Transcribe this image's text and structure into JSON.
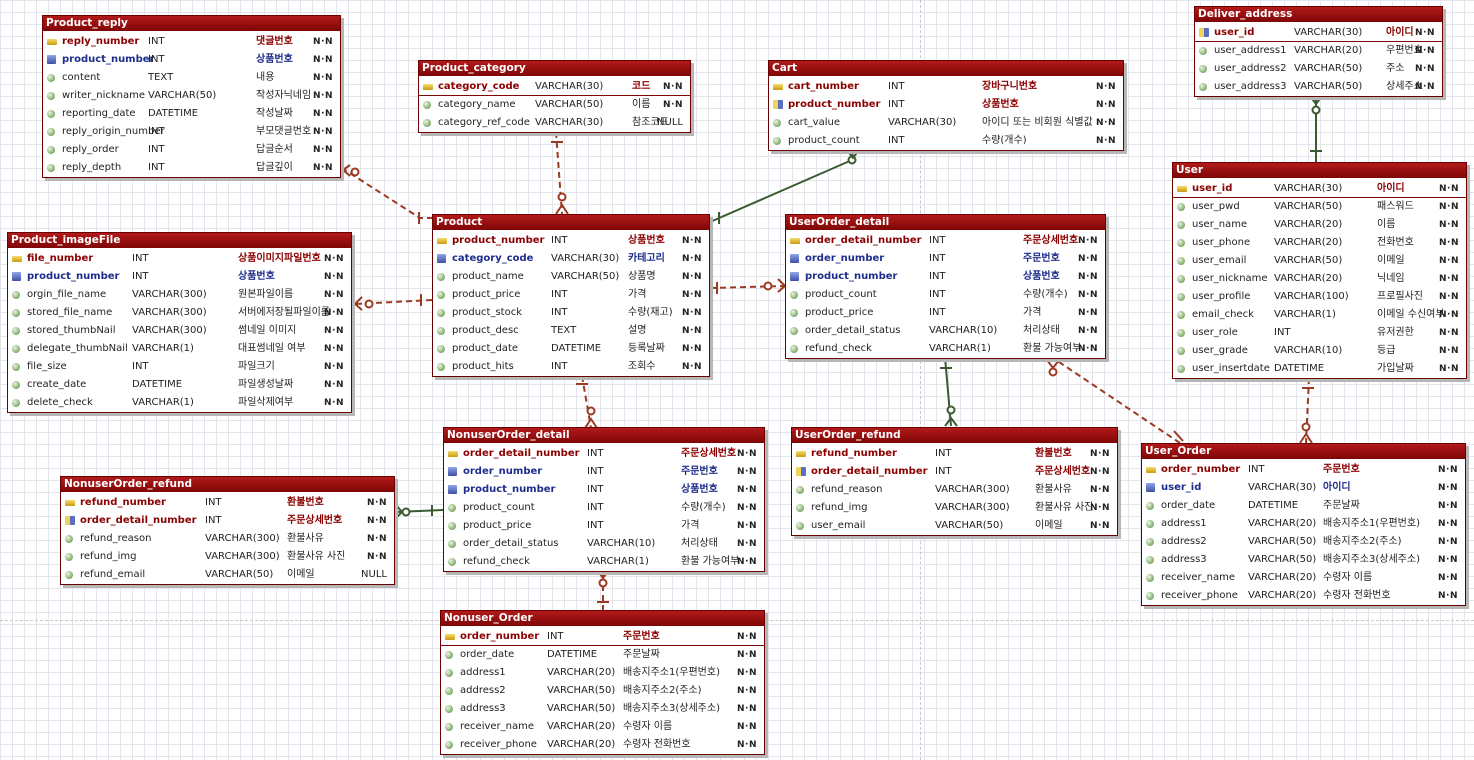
{
  "entities": [
    {
      "id": "product_reply",
      "name": "Product_reply",
      "columns": [
        {
          "name": "reply_number",
          "type": "INT",
          "comment": "댓글번호",
          "nullable": "N·N",
          "role": "pk"
        },
        {
          "name": "product_number",
          "type": "INT",
          "comment": "상품번호",
          "nullable": "N·N",
          "role": "fk"
        },
        {
          "name": "content",
          "type": "TEXT",
          "comment": "내용",
          "nullable": "N·N",
          "role": ""
        },
        {
          "name": "writer_nickname",
          "type": "VARCHAR(50)",
          "comment": "작성자닉네임",
          "nullable": "N·N",
          "role": ""
        },
        {
          "name": "reporting_date",
          "type": "DATETIME",
          "comment": "작성날짜",
          "nullable": "N·N",
          "role": ""
        },
        {
          "name": "reply_origin_number",
          "type": "INT",
          "comment": "부모댓글번호",
          "nullable": "N·N",
          "role": ""
        },
        {
          "name": "reply_order",
          "type": "INT",
          "comment": "답글순서",
          "nullable": "N·N",
          "role": ""
        },
        {
          "name": "reply_depth",
          "type": "INT",
          "comment": "답글깊이",
          "nullable": "N·N",
          "role": ""
        }
      ]
    },
    {
      "id": "product_category",
      "name": "Product_category",
      "columns": [
        {
          "name": "category_code",
          "type": "VARCHAR(30)",
          "comment": "코드",
          "nullable": "N·N",
          "role": "pk"
        },
        {
          "name": "category_name",
          "type": "VARCHAR(50)",
          "comment": "이름",
          "nullable": "N·N",
          "role": ""
        },
        {
          "name": "category_ref_code",
          "type": "VARCHAR(30)",
          "comment": "참조코드",
          "nullable": "NULL",
          "role": ""
        }
      ]
    },
    {
      "id": "cart",
      "name": "Cart",
      "columns": [
        {
          "name": "cart_number",
          "type": "INT",
          "comment": "장바구니번호",
          "nullable": "N·N",
          "role": "pk"
        },
        {
          "name": "product_number",
          "type": "INT",
          "comment": "상품번호",
          "nullable": "N·N",
          "role": "pkfk-red"
        },
        {
          "name": "cart_value",
          "type": "VARCHAR(30)",
          "comment": "아이디 또는 비회원 식별값",
          "nullable": "N·N",
          "role": ""
        },
        {
          "name": "product_count",
          "type": "INT",
          "comment": "수량(개수)",
          "nullable": "N·N",
          "role": ""
        }
      ]
    },
    {
      "id": "deliver_address",
      "name": "Deliver_address",
      "columns": [
        {
          "name": "user_id",
          "type": "VARCHAR(30)",
          "comment": "아이디",
          "nullable": "N·N",
          "role": "pkfk-red"
        },
        {
          "name": "user_address1",
          "type": "VARCHAR(20)",
          "comment": "우편번호",
          "nullable": "N·N",
          "role": ""
        },
        {
          "name": "user_address2",
          "type": "VARCHAR(50)",
          "comment": "주소",
          "nullable": "N·N",
          "role": ""
        },
        {
          "name": "user_address3",
          "type": "VARCHAR(50)",
          "comment": "상세주소",
          "nullable": "N·N",
          "role": ""
        }
      ]
    },
    {
      "id": "user",
      "name": "User",
      "columns": [
        {
          "name": "user_id",
          "type": "VARCHAR(30)",
          "comment": "아이디",
          "nullable": "N·N",
          "role": "pk"
        },
        {
          "name": "user_pwd",
          "type": "VARCHAR(50)",
          "comment": "패스워드",
          "nullable": "N·N",
          "role": ""
        },
        {
          "name": "user_name",
          "type": "VARCHAR(20)",
          "comment": "이름",
          "nullable": "N·N",
          "role": ""
        },
        {
          "name": "user_phone",
          "type": "VARCHAR(20)",
          "comment": "전화번호",
          "nullable": "N·N",
          "role": ""
        },
        {
          "name": "user_email",
          "type": "VARCHAR(50)",
          "comment": "이메일",
          "nullable": "N·N",
          "role": ""
        },
        {
          "name": "user_nickname",
          "type": "VARCHAR(20)",
          "comment": "닉네임",
          "nullable": "N·N",
          "role": ""
        },
        {
          "name": "user_profile",
          "type": "VARCHAR(100)",
          "comment": "프로필사진",
          "nullable": "N·N",
          "role": ""
        },
        {
          "name": "email_check",
          "type": "VARCHAR(1)",
          "comment": "이메일 수신여부",
          "nullable": "N·N",
          "role": ""
        },
        {
          "name": "user_role",
          "type": "INT",
          "comment": "유저권한",
          "nullable": "N·N",
          "role": ""
        },
        {
          "name": "user_grade",
          "type": "VARCHAR(10)",
          "comment": "등급",
          "nullable": "N·N",
          "role": ""
        },
        {
          "name": "user_insertdate",
          "type": "DATETIME",
          "comment": "가입날짜",
          "nullable": "N·N",
          "role": ""
        }
      ]
    },
    {
      "id": "product_imagefile",
      "name": "Product_imageFile",
      "columns": [
        {
          "name": "file_number",
          "type": "INT",
          "comment": "상품이미지파일번호",
          "nullable": "N·N",
          "role": "pk"
        },
        {
          "name": "product_number",
          "type": "INT",
          "comment": "상품번호",
          "nullable": "N·N",
          "role": "fk"
        },
        {
          "name": "orgin_file_name",
          "type": "VARCHAR(300)",
          "comment": "원본파일이름",
          "nullable": "N·N",
          "role": ""
        },
        {
          "name": "stored_file_name",
          "type": "VARCHAR(300)",
          "comment": "서버에저장될파일이름",
          "nullable": "N·N",
          "role": ""
        },
        {
          "name": "stored_thumbNail",
          "type": "VARCHAR(300)",
          "comment": "썸네일 이미지",
          "nullable": "N·N",
          "role": ""
        },
        {
          "name": "delegate_thumbNail",
          "type": "VARCHAR(1)",
          "comment": "대표썸네일 여부",
          "nullable": "N·N",
          "role": ""
        },
        {
          "name": "file_size",
          "type": "INT",
          "comment": "파일크기",
          "nullable": "N·N",
          "role": ""
        },
        {
          "name": "create_date",
          "type": "DATETIME",
          "comment": "파일생성날짜",
          "nullable": "N·N",
          "role": ""
        },
        {
          "name": "delete_check",
          "type": "VARCHAR(1)",
          "comment": "파일삭제여부",
          "nullable": "N·N",
          "role": ""
        }
      ]
    },
    {
      "id": "product",
      "name": "Product",
      "columns": [
        {
          "name": "product_number",
          "type": "INT",
          "comment": "상품번호",
          "nullable": "N·N",
          "role": "pk"
        },
        {
          "name": "category_code",
          "type": "VARCHAR(30)",
          "comment": "카테고리",
          "nullable": "N·N",
          "role": "fk"
        },
        {
          "name": "product_name",
          "type": "VARCHAR(50)",
          "comment": "상품명",
          "nullable": "N·N",
          "role": ""
        },
        {
          "name": "product_price",
          "type": "INT",
          "comment": "가격",
          "nullable": "N·N",
          "role": ""
        },
        {
          "name": "product_stock",
          "type": "INT",
          "comment": "수량(재고)",
          "nullable": "N·N",
          "role": ""
        },
        {
          "name": "product_desc",
          "type": "TEXT",
          "comment": "설명",
          "nullable": "N·N",
          "role": ""
        },
        {
          "name": "product_date",
          "type": "DATETIME",
          "comment": "등록날짜",
          "nullable": "N·N",
          "role": ""
        },
        {
          "name": "product_hits",
          "type": "INT",
          "comment": "조회수",
          "nullable": "N·N",
          "role": ""
        }
      ]
    },
    {
      "id": "userorder_detail",
      "name": "UserOrder_detail",
      "columns": [
        {
          "name": "order_detail_number",
          "type": "INT",
          "comment": "주문상세번호",
          "nullable": "N·N",
          "role": "pk"
        },
        {
          "name": "order_number",
          "type": "INT",
          "comment": "주문번호",
          "nullable": "N·N",
          "role": "fk"
        },
        {
          "name": "product_number",
          "type": "INT",
          "comment": "상품번호",
          "nullable": "N·N",
          "role": "fk"
        },
        {
          "name": "product_count",
          "type": "INT",
          "comment": "수량(개수)",
          "nullable": "N·N",
          "role": ""
        },
        {
          "name": "product_price",
          "type": "INT",
          "comment": "가격",
          "nullable": "N·N",
          "role": ""
        },
        {
          "name": "order_detail_status",
          "type": "VARCHAR(10)",
          "comment": "처리상태",
          "nullable": "N·N",
          "role": ""
        },
        {
          "name": "refund_check",
          "type": "VARCHAR(1)",
          "comment": "환불 가능여부",
          "nullable": "N·N",
          "role": ""
        }
      ]
    },
    {
      "id": "nonuserorder_detail",
      "name": "NonuserOrder_detail",
      "columns": [
        {
          "name": "order_detail_number",
          "type": "INT",
          "comment": "주문상세번호",
          "nullable": "N·N",
          "role": "pk"
        },
        {
          "name": "order_number",
          "type": "INT",
          "comment": "주문번호",
          "nullable": "N·N",
          "role": "fk"
        },
        {
          "name": "product_number",
          "type": "INT",
          "comment": "상품번호",
          "nullable": "N·N",
          "role": "fk"
        },
        {
          "name": "product_count",
          "type": "INT",
          "comment": "수량(개수)",
          "nullable": "N·N",
          "role": ""
        },
        {
          "name": "product_price",
          "type": "INT",
          "comment": "가격",
          "nullable": "N·N",
          "role": ""
        },
        {
          "name": "order_detail_status",
          "type": "VARCHAR(10)",
          "comment": "처리상태",
          "nullable": "N·N",
          "role": ""
        },
        {
          "name": "refund_check",
          "type": "VARCHAR(1)",
          "comment": "환불 가능여부",
          "nullable": "N·N",
          "role": ""
        }
      ]
    },
    {
      "id": "userorder_refund",
      "name": "UserOrder_refund",
      "columns": [
        {
          "name": "refund_number",
          "type": "INT",
          "comment": "환불번호",
          "nullable": "N·N",
          "role": "pk"
        },
        {
          "name": "order_detail_number",
          "type": "INT",
          "comment": "주문상세번호",
          "nullable": "N·N",
          "role": "pkfk-red"
        },
        {
          "name": "refund_reason",
          "type": "VARCHAR(300)",
          "comment": "환불사유",
          "nullable": "N·N",
          "role": ""
        },
        {
          "name": "refund_img",
          "type": "VARCHAR(300)",
          "comment": "환불사유 사진",
          "nullable": "N·N",
          "role": ""
        },
        {
          "name": "user_email",
          "type": "VARCHAR(50)",
          "comment": "이메일",
          "nullable": "N·N",
          "role": ""
        }
      ]
    },
    {
      "id": "user_order",
      "name": "User_Order",
      "columns": [
        {
          "name": "order_number",
          "type": "INT",
          "comment": "주문번호",
          "nullable": "N·N",
          "role": "pk"
        },
        {
          "name": "user_id",
          "type": "VARCHAR(30)",
          "comment": "아이디",
          "nullable": "N·N",
          "role": "fk"
        },
        {
          "name": "order_date",
          "type": "DATETIME",
          "comment": "주문날짜",
          "nullable": "N·N",
          "role": ""
        },
        {
          "name": "address1",
          "type": "VARCHAR(20)",
          "comment": "배송지주소1(우편번호)",
          "nullable": "N·N",
          "role": ""
        },
        {
          "name": "address2",
          "type": "VARCHAR(50)",
          "comment": "배송지주소2(주소)",
          "nullable": "N·N",
          "role": ""
        },
        {
          "name": "address3",
          "type": "VARCHAR(50)",
          "comment": "배송지주소3(상세주소)",
          "nullable": "N·N",
          "role": ""
        },
        {
          "name": "receiver_name",
          "type": "VARCHAR(20)",
          "comment": "수령자 이름",
          "nullable": "N·N",
          "role": ""
        },
        {
          "name": "receiver_phone",
          "type": "VARCHAR(20)",
          "comment": "수령자 전화번호",
          "nullable": "N·N",
          "role": ""
        }
      ]
    },
    {
      "id": "nonuserorder_refund",
      "name": "NonuserOrder_refund",
      "columns": [
        {
          "name": "refund_number",
          "type": "INT",
          "comment": "환불번호",
          "nullable": "N·N",
          "role": "pk"
        },
        {
          "name": "order_detail_number",
          "type": "INT",
          "comment": "주문상세번호",
          "nullable": "N·N",
          "role": "pkfk-red"
        },
        {
          "name": "refund_reason",
          "type": "VARCHAR(300)",
          "comment": "환불사유",
          "nullable": "N·N",
          "role": ""
        },
        {
          "name": "refund_img",
          "type": "VARCHAR(300)",
          "comment": "환불사유 사진",
          "nullable": "N·N",
          "role": ""
        },
        {
          "name": "refund_email",
          "type": "VARCHAR(50)",
          "comment": "이메일",
          "nullable": "NULL",
          "role": ""
        }
      ]
    },
    {
      "id": "nonuser_order",
      "name": "Nonuser_Order",
      "columns": [
        {
          "name": "order_number",
          "type": "INT",
          "comment": "주문번호",
          "nullable": "N·N",
          "role": "pk"
        },
        {
          "name": "order_date",
          "type": "DATETIME",
          "comment": "주문날짜",
          "nullable": "N·N",
          "role": ""
        },
        {
          "name": "address1",
          "type": "VARCHAR(20)",
          "comment": "배송지주소1(우편번호)",
          "nullable": "N·N",
          "role": ""
        },
        {
          "name": "address2",
          "type": "VARCHAR(50)",
          "comment": "배송지주소2(주소)",
          "nullable": "N·N",
          "role": ""
        },
        {
          "name": "address3",
          "type": "VARCHAR(50)",
          "comment": "배송지주소3(상세주소)",
          "nullable": "N·N",
          "role": ""
        },
        {
          "name": "receiver_name",
          "type": "VARCHAR(20)",
          "comment": "수령자 이름",
          "nullable": "N·N",
          "role": ""
        },
        {
          "name": "receiver_phone",
          "type": "VARCHAR(20)",
          "comment": "수령자 전화번호",
          "nullable": "N·N",
          "role": ""
        }
      ]
    }
  ],
  "relationships": [
    {
      "from": "product",
      "to": "product_reply",
      "style": "non-identifying"
    },
    {
      "from": "product_category",
      "to": "product",
      "style": "non-identifying"
    },
    {
      "from": "product",
      "to": "cart",
      "style": "identifying"
    },
    {
      "from": "product",
      "to": "product_imagefile",
      "style": "non-identifying"
    },
    {
      "from": "product",
      "to": "userorder_detail",
      "style": "non-identifying"
    },
    {
      "from": "product",
      "to": "nonuserorder_detail",
      "style": "non-identifying"
    },
    {
      "from": "user",
      "to": "deliver_address",
      "style": "identifying"
    },
    {
      "from": "user",
      "to": "user_order",
      "style": "non-identifying"
    },
    {
      "from": "user_order",
      "to": "userorder_detail",
      "style": "non-identifying"
    },
    {
      "from": "userorder_detail",
      "to": "userorder_refund",
      "style": "identifying"
    },
    {
      "from": "nonuserorder_detail",
      "to": "nonuserorder_refund",
      "style": "identifying"
    },
    {
      "from": "nonuser_order",
      "to": "nonuserorder_detail",
      "style": "non-identifying"
    }
  ],
  "colors": {
    "header": "#8b0a0a",
    "identifying_line": "#3c5a32",
    "non_identifying_line": "#9b3a22",
    "pk_text": "#8b0000",
    "fk_text": "#1e2d8c"
  }
}
